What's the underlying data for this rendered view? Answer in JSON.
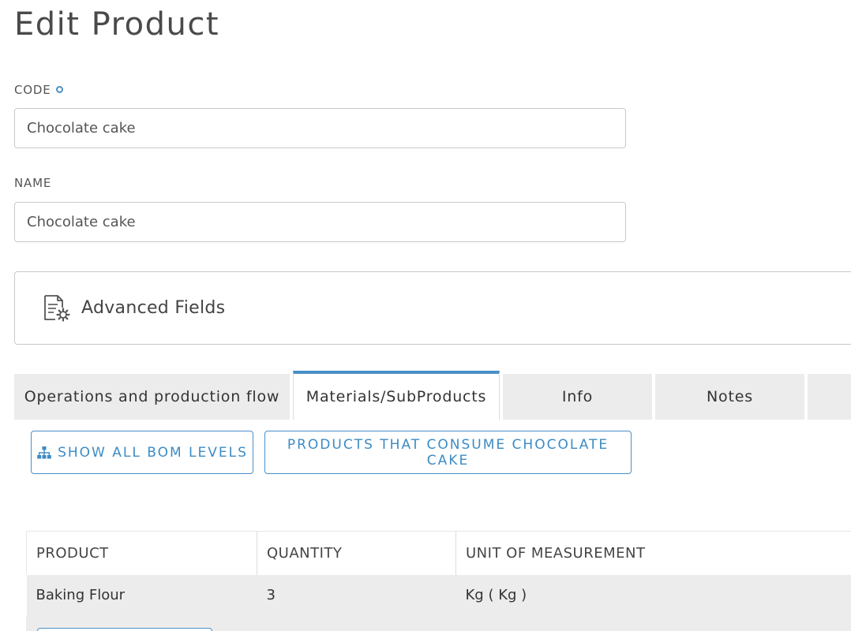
{
  "page": {
    "title": "Edit Product"
  },
  "form": {
    "code_label": "CODE",
    "code_value": "Chocolate cake",
    "name_label": "NAME",
    "name_value": "Chocolate cake"
  },
  "advanced": {
    "label": "Advanced Fields",
    "icon": "document-settings-icon"
  },
  "tabs": [
    {
      "label": "Operations and production flow",
      "active": false
    },
    {
      "label": "Materials/SubProducts",
      "active": true
    },
    {
      "label": "Info",
      "active": false
    },
    {
      "label": "Notes",
      "active": false
    },
    {
      "label": "",
      "active": false
    }
  ],
  "actions": {
    "show_bom_label": "SHOW ALL BOM LEVELS",
    "show_bom_icon": "sitemap-icon",
    "consumers_label": "PRODUCTS THAT CONSUME CHOCOLATE CAKE"
  },
  "materials_table": {
    "columns": [
      "PRODUCT",
      "QUANTITY",
      "UNIT OF MEASUREMENT"
    ],
    "rows": [
      {
        "product": "Baking Flour",
        "quantity": "3",
        "unit": "Kg ( Kg )"
      }
    ]
  },
  "colors": {
    "accent": "#4a90c8",
    "tab_bg": "#ececec",
    "border": "#c9c9c9"
  }
}
